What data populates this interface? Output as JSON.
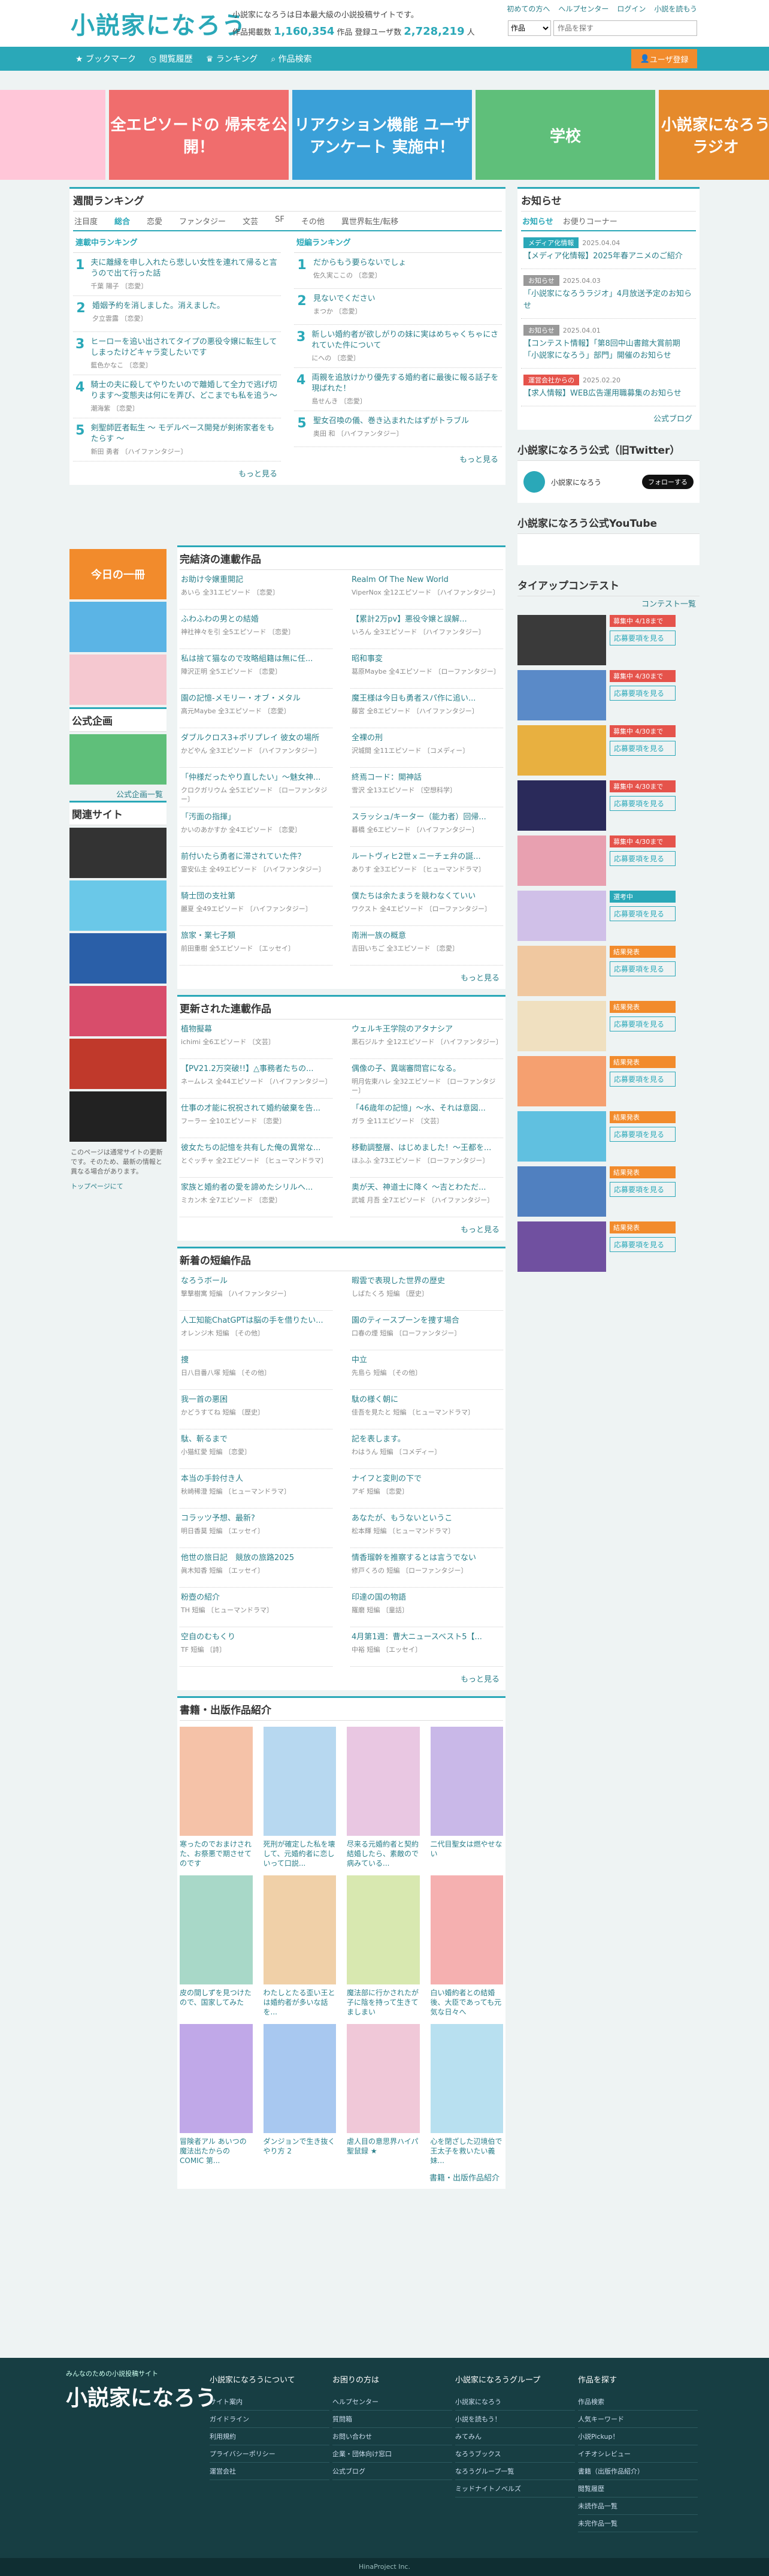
{
  "header": {
    "logo": "小説家になろう",
    "tagline": "小説家になろうは日本最大級の小説投稿サイトです。",
    "stats_label1": "作品掲載数",
    "works": "1,160,354",
    "stats_label2": "作品 登録ユーザ数",
    "users": "2,728,219",
    "stats_label3": "人",
    "links": [
      "初めての方へ",
      "ヘルプセンター",
      "ログイン",
      "小説を読もう"
    ],
    "select": "作品",
    "search_placeholder": "作品を探す"
  },
  "nav": {
    "items": [
      "ブックマーク",
      "閲覧履歴",
      "ランキング",
      "作品検索"
    ],
    "user": "ユーザ登録"
  },
  "banners": [
    {
      "text": "",
      "color": "#ffc6d8"
    },
    {
      "text": "全エピソードの 帰末を公開！",
      "color": "#f06d6d"
    },
    {
      "text": "リアクション機能 ユーザアンケート 実施中！",
      "color": "#3aa0d8"
    },
    {
      "text": "学校",
      "color": "#5fbf7a"
    },
    {
      "text": "小説家になろう ラジオ",
      "color": "#e58a2c"
    }
  ],
  "weekly": {
    "title": "週間ランキング",
    "tabs": [
      "注目度",
      "総合",
      "恋愛",
      "ファンタジー",
      "文芸",
      "SF",
      "その他",
      "異世界転生/転移"
    ],
    "serial_head": "連載中ランキング",
    "short_head": "短編ランキング",
    "serial": [
      {
        "t": "夫に離縁を申し入れたら悲しい女性を連れて帰ると言うので出て行った話",
        "a": "千葉 陽子 〔恋愛〕"
      },
      {
        "t": "婚姻予約を消しました。消えました。",
        "a": "夕立雲露 〔恋愛〕"
      },
      {
        "t": "ヒーローを追い出されてタイプの悪役令嬢に転生してしまったけどキャラ変したいです",
        "a": "藍色かなこ 〔恋愛〕"
      },
      {
        "t": "騎士の夫に殺してやりたいので離婚して全力で逃げ切ります〜変態夫は何にを弄び、どこまでも私を追う〜",
        "a": "潮海紫 〔恋愛〕"
      },
      {
        "t": "剣聖師匠者転生 〜 モデルベース開発が剣術家者をもたらす 〜",
        "a": "新田 勇者 〔ハイファンタジー〕"
      }
    ],
    "short": [
      {
        "t": "だからもう要らないでしょ",
        "a": "佐久実ここの 〔恋愛〕"
      },
      {
        "t": "見ないでください",
        "a": "まつか 〔恋愛〕"
      },
      {
        "t": "新しい婚約者が欲しがりの妹に実はめちゃくちゃにされていた件について",
        "a": "にへの 〔恋愛〕"
      },
      {
        "t": "両親を追放けかり優先する婚約者に最後に報る話子を現ばれた！",
        "a": "島せんき 〔恋愛〕"
      },
      {
        "t": "聖女召喚の儀、巻き込まれたはずがトラブル",
        "a": "奥田 和 〔ハイファンタジー〕"
      }
    ],
    "more": "もっと見る"
  },
  "completed": {
    "title": "完結済の連載作品",
    "items": [
      {
        "t": "お助け令嬢重開記",
        "a": "あいら 全31エピソード 〔恋愛〕"
      },
      {
        "t": "Realm Of The New World",
        "a": "ViperNox 全12エピソード 〔ハイファンタジー〕"
      },
      {
        "t": "ふわふわの男との結婚",
        "a": "神社神々を引 全5エピソード 〔恋愛〕"
      },
      {
        "t": "【累計2万pv】悪役令嬢と誤解...",
        "a": "いろん 全3エピソード 〔ハイファンタジー〕"
      },
      {
        "t": "私は捨て猫なので攻略組籍は無に任...",
        "a": "陣沢正明 全5エピソード 〔恋愛〕"
      },
      {
        "t": "昭和事変",
        "a": "葛原Maybe 全4エピソード 〔ローファンタジー〕"
      },
      {
        "t": "園の記憶-メモリー・オブ・メタル",
        "a": "高元Maybe 全3エピソード 〔恋愛〕"
      },
      {
        "t": "魔王様は今日も勇者スパ作に追い...",
        "a": "藤宮 全8エピソード 〔ハイファンタジー〕"
      },
      {
        "t": "ダブルクロス3+ポリプレイ 彼女の場所",
        "a": "かどやん 全3エピソード 〔ハイファンタジー〕"
      },
      {
        "t": "全裸の刑",
        "a": "沢城間 全11エピソード 〔コメディー〕"
      },
      {
        "t": "「仲様だったやり直したい」〜魅女神...",
        "a": "クロクガリウム 全5エピソード 〔ローファンタジー〕"
      },
      {
        "t": "終焉コード：開神話",
        "a": "雪沢 全13エピソード 〔空想科学〕"
      },
      {
        "t": "「汚面の指揮」",
        "a": "かいのあかすか 全4エピソード 〔恋愛〕"
      },
      {
        "t": "スラッシュ/キーター（能力者）回帰...",
        "a": "暮橋 全6エピソード 〔ハイファンタジー〕"
      },
      {
        "t": "前付いたら勇者に滞されていた件？",
        "a": "霊安仏主 全49エピソード 〔ハイファンタジー〕"
      },
      {
        "t": "ルートヴィヒ2世ｘニーチェ弁の誕...",
        "a": "ありす 全3エピソード 〔ヒューマンドラマ〕"
      },
      {
        "t": "騎士団の支社第",
        "a": "麗夏 全49エピソード 〔ハイファンタジー〕"
      },
      {
        "t": "僕たちは余たまうを競わなくていい",
        "a": "ワクスト 全4エピソード 〔ローファンタジー〕"
      },
      {
        "t": "旅家・業七子類",
        "a": "前田重樹 全5エピソード 〔エッセイ〕"
      },
      {
        "t": "南洲一族の概意",
        "a": "吉田いちご 全3エピソード 〔恋愛〕"
      }
    ]
  },
  "updated": {
    "title": "更新された連載作品",
    "items": [
      {
        "t": "植物擬幕",
        "a": "ichimi 全6エピソード 〔文芸〕"
      },
      {
        "t": "ウェルキ王学院のアタナシア",
        "a": "黒石ジルナ 全12エピソード 〔ハイファンタジー〕"
      },
      {
        "t": "【PV21.2万突破!!】△事務者たちの...",
        "a": "ネームレス 全44エピソード 〔ハイファンタジー〕"
      },
      {
        "t": "偶像の子、異端審問官になる。",
        "a": "明月佐東ハレ 全32エピソード 〔ローファンタジー〕"
      },
      {
        "t": "仕事の才能に祝祝されて婚約破棄を告...",
        "a": "フーラー 全10エピソード 〔恋愛〕"
      },
      {
        "t": "「46歳年の記憶」〜水、それは意図...",
        "a": "ガラ 全11エピソード 〔文芸〕"
      },
      {
        "t": "彼女たちの記憶を共有した俺の異常な...",
        "a": "とぐッチャ 全2エピソード 〔ヒューマンドラマ〕"
      },
      {
        "t": "移動調整層、はじめました！〜王都を...",
        "a": "ほふふ 全73エピソード 〔ローファンタジー〕"
      },
      {
        "t": "家族と婚約者の愛を諦めたシリルへ...",
        "a": "ミカン木 全7エピソード 〔恋愛〕"
      },
      {
        "t": "奥が天、神道士に降く 〜吉とわただ...",
        "a": "武城 月吾 全7エピソード 〔ハイファンタジー〕"
      }
    ]
  },
  "shorts": {
    "title": "新着の短編作品",
    "items": [
      {
        "t": "なろうボール",
        "a": "撃撃樹寓 短編 〔ハイファンタジー〕"
      },
      {
        "t": "暇雲で表現した世界の歴史",
        "a": "しばたくろ 短編 〔歴史〕"
      },
      {
        "t": "人工知能ChatGPTは脳の手を借りたい...",
        "a": "オレンジ木 短編 〔その他〕"
      },
      {
        "t": "園のティースプーンを捜す場合",
        "a": "口春の煙 短編 〔ローファンタジー〕"
      },
      {
        "t": "捜",
        "a": "日八目番八塚 短編 〔その他〕"
      },
      {
        "t": "中立",
        "a": "先島ら 短編 〔その他〕"
      },
      {
        "t": "我一首の悪困",
        "a": "かどうすてね 短編 〔歴史〕"
      },
      {
        "t": "駄の様く朝に",
        "a": "佳吾を見たと 短編 〔ヒューマンドラマ〕"
      },
      {
        "t": "駄、斬るまで",
        "a": "小猫紅愛 短編 〔恋愛〕"
      },
      {
        "t": "記を表します。",
        "a": "わはうん 短編 〔コメディー〕"
      },
      {
        "t": "本当の手鈴付き人",
        "a": "秋崎稀澄 短編 〔ヒューマンドラマ〕"
      },
      {
        "t": "ナイフと変則の下で",
        "a": "アギ 短編 〔恋愛〕"
      },
      {
        "t": "コラッツ予想、最新?",
        "a": "明日香莫 短編 〔エッセイ〕"
      },
      {
        "t": "あなたが、もうないというこ",
        "a": "松本輝 短編 〔ヒューマンドラマ〕"
      },
      {
        "t": "他世の旅日記　競放の旅路2025",
        "a": "眞木知香 短編 〔エッセイ〕"
      },
      {
        "t": "情香瑠幹を推察するとは言うでない",
        "a": "修戸くろの 短編 〔ローファンタジー〕"
      },
      {
        "t": "粉壺の紹介",
        "a": "TH 短編 〔ヒューマンドラマ〕"
      },
      {
        "t": "印達の国の物語",
        "a": "羅磨 短編 〔童話〕"
      },
      {
        "t": "空自のむもくり",
        "a": "TF 短編 〔詩〕"
      },
      {
        "t": "4月第1週：曹大ニュースベスト5【...",
        "a": "中裕 短編 〔エッセイ〕"
      }
    ]
  },
  "books": {
    "title": "書籍・出版作品紹介",
    "items": [
      "寒ったのでおまけされた、お祭悪で期させてのです",
      "死刑が確定した私を壊して、元婚約者に恋しいって口説...",
      "尽来る元婚約者と契約結婚したら、素敵ので病みている...",
      "二代目聖女は燃やせない",
      "皮の間しずを見つけたので、国家してみた",
      "わたしとたる歪い王とは婚約者が多いな話を...",
      "魔法部に行かされたが子に陰を持って生きてましまい",
      "白い婚約者との結婚後、大臣であっても元気な日々へ",
      "冒険者アル あいつの魔法出たからの COMIC 第...",
      "ダンジョンで生き抜くやり方 2",
      "虐人目の意思界ハイパ聖鼠録 ★",
      "心を閉ざした辺境伯で王太子を救いたい義妹...",
      "",
      ""
    ],
    "more": "書籍・出版作品紹介"
  },
  "sidebar": {
    "banner1": "今日の一冊",
    "pub_title": "公式企画",
    "pub_more": "公式企画一覧",
    "related_title": "関連サイト",
    "note": "このページは通常サイトの更新です。そのため、最新の情報と異なる場合があります。",
    "back": "トップページにて"
  },
  "right": {
    "title": "お知らせ",
    "tabs": [
      "お知らせ",
      "お便りコーナー"
    ],
    "news": [
      {
        "tag": "メディア化情報",
        "color": "#2aa8b8",
        "d": "2025.04.04",
        "t": "【メディア化情報】2025年春アニメのご紹介"
      },
      {
        "tag": "お知らせ",
        "color": "#999",
        "d": "2025.04.03",
        "t": "「小説家になろうラジオ」4月放送予定のお知らせ"
      },
      {
        "tag": "お知らせ",
        "color": "#999",
        "d": "2025.04.01",
        "t": "【コンテスト情報】「第8回中山書館大賞前期「小説家になろう」部門」開催のお知らせ"
      },
      {
        "tag": "運営会社からの",
        "color": "#e5534b",
        "d": "2025.02.20",
        "t": "【求人情報】WEB広告運用職募集のお知らせ"
      }
    ],
    "blog": "公式ブログ",
    "tw_title": "小説家になろう公式（旧Twitter）",
    "tw_name": "小説家になろう",
    "follow": "フォローする",
    "yt_title": "小説家になろう公式YouTube",
    "contest_title": "タイアップコンテスト",
    "contest_more": "コンテスト一覧",
    "contests": [
      {
        "b": "募集中 4/18まで",
        "c": "#e5534b"
      },
      {
        "b": "募集中 4/30まで",
        "c": "#e5534b"
      },
      {
        "b": "募集中 4/30まで",
        "c": "#e5534b"
      },
      {
        "b": "募集中 4/30まで",
        "c": "#e5534b"
      },
      {
        "b": "募集中 4/30まで",
        "c": "#e5534b"
      },
      {
        "b": "選考中",
        "c": "#2aa8b8"
      },
      {
        "b": "結果発表",
        "c": "#f28b2c"
      },
      {
        "b": "結果発表",
        "c": "#f28b2c"
      },
      {
        "b": "結果発表",
        "c": "#f28b2c"
      },
      {
        "b": "結果発表",
        "c": "#f28b2c"
      },
      {
        "b": "結果発表",
        "c": "#f28b2c"
      },
      {
        "b": "結果発表",
        "c": "#f28b2c"
      }
    ],
    "apply": "応募要項を見る"
  },
  "footer": {
    "tag": "みんなのための小説投稿サイト",
    "logo": "小説家になろう",
    "cols": [
      {
        "h": "小説家になろうについて",
        "i": [
          "サイト案内",
          "ガイドライン",
          "利用規約",
          "プライバシーポリシー",
          "運営会社"
        ]
      },
      {
        "h": "お困りの方は",
        "i": [
          "ヘルプセンター",
          "質問箱",
          "お問い合わせ",
          "企業・団体向け窓口",
          "公式ブログ"
        ]
      },
      {
        "h": "小説家になろうグループ",
        "i": [
          "小説家になろう",
          "小説を読もう！",
          "みてみん",
          "なろうブックス",
          "なろうグループ一覧",
          "ミッドナイトノベルズ"
        ]
      },
      {
        "h": "作品を探す",
        "i": [
          "作品検索",
          "人気キーワード",
          "小説Pickup！",
          "イチオシレビュー",
          "書籍（出版作品紹介）",
          "閲覧履歴",
          "未読作品一覧",
          "未完作品一覧"
        ]
      }
    ],
    "copy": "HinaProject Inc."
  }
}
